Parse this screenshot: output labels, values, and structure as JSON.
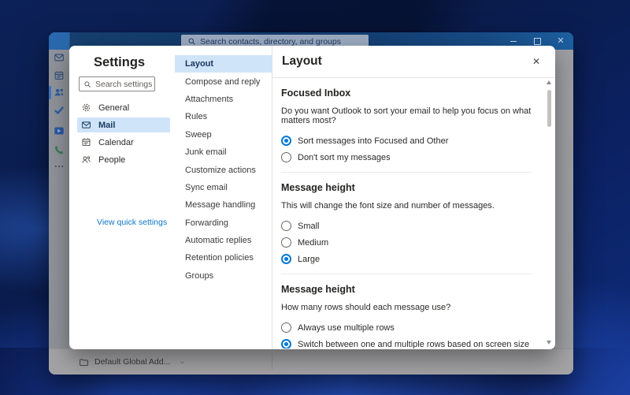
{
  "colors": {
    "accent": "#0078d4",
    "selected_highlight": "#cfe4f8",
    "titlebar_dark": "#123868",
    "titlebar_light": "#1c5f9f",
    "dialog_bg": "#ffffff"
  },
  "titlebar": {
    "search_placeholder": "Search contacts, directory, and groups",
    "controls": [
      {
        "name": "minimize"
      },
      {
        "name": "maximize"
      },
      {
        "name": "close"
      }
    ]
  },
  "rail": {
    "items": [
      {
        "icon": "mail-icon"
      },
      {
        "icon": "calendar-icon"
      },
      {
        "icon": "people-icon",
        "selected": true
      },
      {
        "icon": "todo-check-icon"
      },
      {
        "icon": "app-arrow-icon"
      },
      {
        "icon": "calls-icon"
      },
      {
        "icon": "more-icon"
      }
    ]
  },
  "folder_bar": {
    "label": "Default Global Add..."
  },
  "settings_dialog": {
    "title": "Settings",
    "search_placeholder": "Search settings",
    "categories": [
      {
        "icon": "gear-icon",
        "label": "General",
        "selected": false
      },
      {
        "icon": "mail-icon",
        "label": "Mail",
        "selected": true
      },
      {
        "icon": "calendar-icon",
        "label": "Calendar",
        "selected": false
      },
      {
        "icon": "people-icon",
        "label": "People",
        "selected": false
      }
    ],
    "quick_link": "View quick settings",
    "nav": [
      {
        "label": "Layout",
        "selected": true
      },
      {
        "label": "Compose and reply",
        "selected": false
      },
      {
        "label": "Attachments",
        "selected": false
      },
      {
        "label": "Rules",
        "selected": false
      },
      {
        "label": "Sweep",
        "selected": false
      },
      {
        "label": "Junk email",
        "selected": false
      },
      {
        "label": "Customize actions",
        "selected": false
      },
      {
        "label": "Sync email",
        "selected": false
      },
      {
        "label": "Message handling",
        "selected": false
      },
      {
        "label": "Forwarding",
        "selected": false
      },
      {
        "label": "Automatic replies",
        "selected": false
      },
      {
        "label": "Retention policies",
        "selected": false
      },
      {
        "label": "Groups",
        "selected": false
      }
    ],
    "panel": {
      "title": "Layout",
      "groups": [
        {
          "heading": "Focused Inbox",
          "question": "Do you want Outlook to sort your email to help you focus on what matters most?",
          "options": [
            {
              "label": "Sort messages into Focused and Other",
              "selected": true
            },
            {
              "label": "Don't sort my messages",
              "selected": false
            }
          ]
        },
        {
          "heading": "Message height",
          "question": "This will change the font size and number of messages.",
          "options": [
            {
              "label": "Small",
              "selected": false
            },
            {
              "label": "Medium",
              "selected": false
            },
            {
              "label": "Large",
              "selected": true
            }
          ]
        },
        {
          "heading": "Message height",
          "question": "How many rows should each message use?",
          "options": [
            {
              "label": "Always use multiple rows",
              "selected": false
            },
            {
              "label": "Switch between one and multiple rows based on screen size",
              "selected": true
            }
          ]
        }
      ]
    }
  }
}
